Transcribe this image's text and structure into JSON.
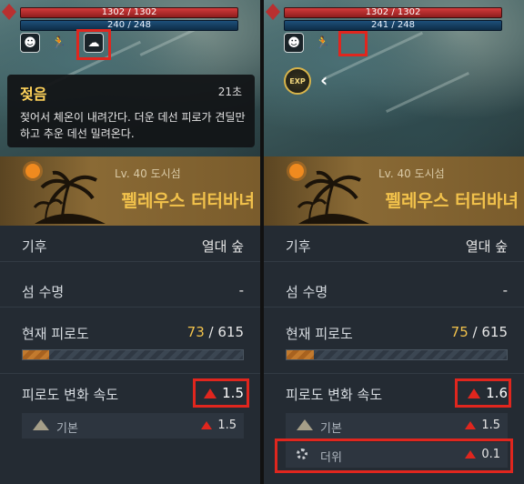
{
  "left": {
    "hp": "1302 / 1302",
    "mp": "240 / 248",
    "tooltip": {
      "title": "젖음",
      "time": "21초",
      "desc": "젖어서 체온이 내려간다. 더운 데선 피로가 견딜만하고 추운 데선 밀려온다."
    },
    "island": {
      "level": "Lv. 40 도시섬",
      "name": "펠레우스 터터바녀"
    },
    "rows": {
      "climate_label": "기후",
      "climate_value": "열대 숲",
      "lifespan_label": "섬 수명",
      "lifespan_value": "-",
      "fatigue_label": "현재 피로도",
      "fatigue_current": "73",
      "fatigue_max": "/ 615",
      "rate_label": "피로도 변화 속도",
      "rate_value": "1.5"
    },
    "fatigue_progress": 0.118,
    "modifiers": [
      {
        "label": "기본",
        "value": "1.5"
      }
    ]
  },
  "right": {
    "hp": "1302 / 1302",
    "mp": "241 / 248",
    "exp_label": "EXP",
    "island": {
      "level": "Lv. 40 도시섬",
      "name": "펠레우스 터터바녀"
    },
    "rows": {
      "climate_label": "기후",
      "climate_value": "열대 숲",
      "lifespan_label": "섬 수명",
      "lifespan_value": "-",
      "fatigue_label": "현재 피로도",
      "fatigue_current": "75",
      "fatigue_max": "/ 615",
      "rate_label": "피로도 변화 속도",
      "rate_value": "1.6"
    },
    "fatigue_progress": 0.122,
    "modifiers": [
      {
        "label": "기본",
        "value": "1.5"
      },
      {
        "label": "더위",
        "value": "0.1"
      }
    ]
  },
  "colors": {
    "accent_red": "#e0261e",
    "gold": "#f2c24b",
    "panel": "#242b33"
  }
}
